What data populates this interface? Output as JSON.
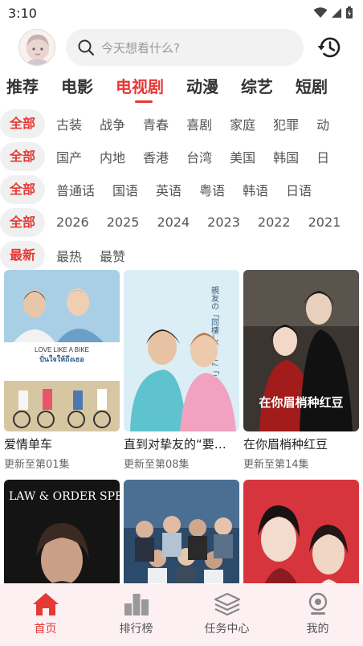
{
  "status_bar": {
    "time": "3:10"
  },
  "search": {
    "placeholder": "今天想看什么?"
  },
  "tabs": [
    {
      "label": "推荐",
      "active": false
    },
    {
      "label": "电影",
      "active": false
    },
    {
      "label": "电视剧",
      "active": true
    },
    {
      "label": "动漫",
      "active": false
    },
    {
      "label": "综艺",
      "active": false
    },
    {
      "label": "短剧",
      "active": false
    }
  ],
  "filters": {
    "genre": {
      "selected": "全部",
      "options": [
        "古装",
        "战争",
        "青春",
        "喜剧",
        "家庭",
        "犯罪",
        "动"
      ]
    },
    "region": {
      "selected": "全部",
      "options": [
        "国产",
        "内地",
        "香港",
        "台湾",
        "美国",
        "韩国",
        "日"
      ]
    },
    "language": {
      "selected": "全部",
      "options": [
        "普通话",
        "国语",
        "英语",
        "粤语",
        "韩语",
        "日语"
      ]
    },
    "year": {
      "selected": "全部",
      "options": [
        "2026",
        "2025",
        "2024",
        "2023",
        "2022",
        "2021"
      ]
    },
    "sort": {
      "selected": "最新",
      "options": [
        "最热",
        "最赞"
      ]
    }
  },
  "videos": [
    {
      "title": "爱情单车",
      "status": "更新至第01集",
      "poster_text": "LOVE LIKE A BIKE"
    },
    {
      "title": "直到对挚友的“要…",
      "status": "更新至第08集",
      "poster_text": "親友の「同棲して」に「うん」て言うまで"
    },
    {
      "title": "在你眉梢种红豆",
      "status": "更新至第14集",
      "poster_text": "在你眉梢种红豆"
    },
    {
      "title": "",
      "status": "",
      "poster_text": "LAW & ORDER SPECIAL VICTIMS UNIT"
    },
    {
      "title": "",
      "status": "",
      "poster_text": ""
    },
    {
      "title": "",
      "status": "",
      "poster_text": ""
    }
  ],
  "bottom_nav": [
    {
      "label": "首页",
      "icon": "home-icon",
      "active": true
    },
    {
      "label": "排行榜",
      "icon": "ranking-icon",
      "active": false
    },
    {
      "label": "任务中心",
      "icon": "task-center-icon",
      "active": false
    },
    {
      "label": "我的",
      "icon": "profile-icon",
      "active": false
    }
  ],
  "colors": {
    "accent": "#e53935",
    "nav_bg": "#fdf0f3",
    "chip_bg": "#f0f0f0"
  }
}
